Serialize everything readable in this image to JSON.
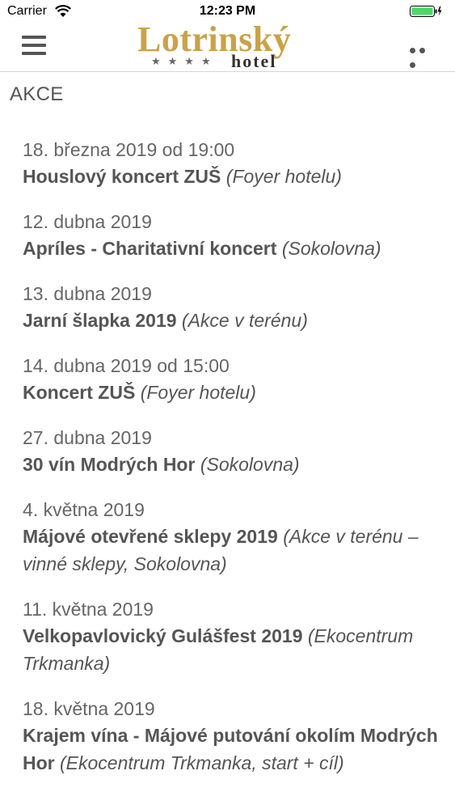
{
  "status_bar": {
    "carrier": "Carrier",
    "time": "12:23 PM"
  },
  "header": {
    "logo_name": "Lotrinský",
    "logo_stars": "★★★★",
    "logo_sub": "hotel"
  },
  "icons": [
    "hamburger-menu-icon",
    "more-icon",
    "wifi-icon",
    "battery-icon"
  ],
  "colors": {
    "brand_gold": "#c9a24a",
    "text": "#555555",
    "battery": "#4cd964"
  },
  "section_title": "AKCE",
  "events": [
    {
      "date": "18. března 2019 od 19:00",
      "name": "Houslový koncert ZUŠ",
      "place": "(Foyer hotelu)"
    },
    {
      "date": "12. dubna 2019",
      "name": "Apríles - Charitativní koncert",
      "place": "(Sokolovna)"
    },
    {
      "date": "13. dubna 2019",
      "name": "Jarní šlapka 2019",
      "place": "(Akce v terénu)"
    },
    {
      "date": "14. dubna 2019 od 15:00",
      "name": "Koncert ZUŠ",
      "place": "(Foyer hotelu)"
    },
    {
      "date": "27. dubna 2019",
      "name": "30 vín Modrých Hor",
      "place": "(Sokolovna)"
    },
    {
      "date": "4. května 2019",
      "name": "Májové otevřené sklepy 2019",
      "place": "(Akce v terénu – vinné sklepy, Sokolovna)"
    },
    {
      "date": "11. května 2019",
      "name": "Velkopavlovický Gulášfest 2019",
      "place": "(Ekocentrum Trkmanka)"
    },
    {
      "date": "18. května 2019",
      "name": "Krajem vína - Májové putování okolím Modrých Hor",
      "place": "(Ekocentrum Trkmanka, start + cíl)"
    }
  ]
}
